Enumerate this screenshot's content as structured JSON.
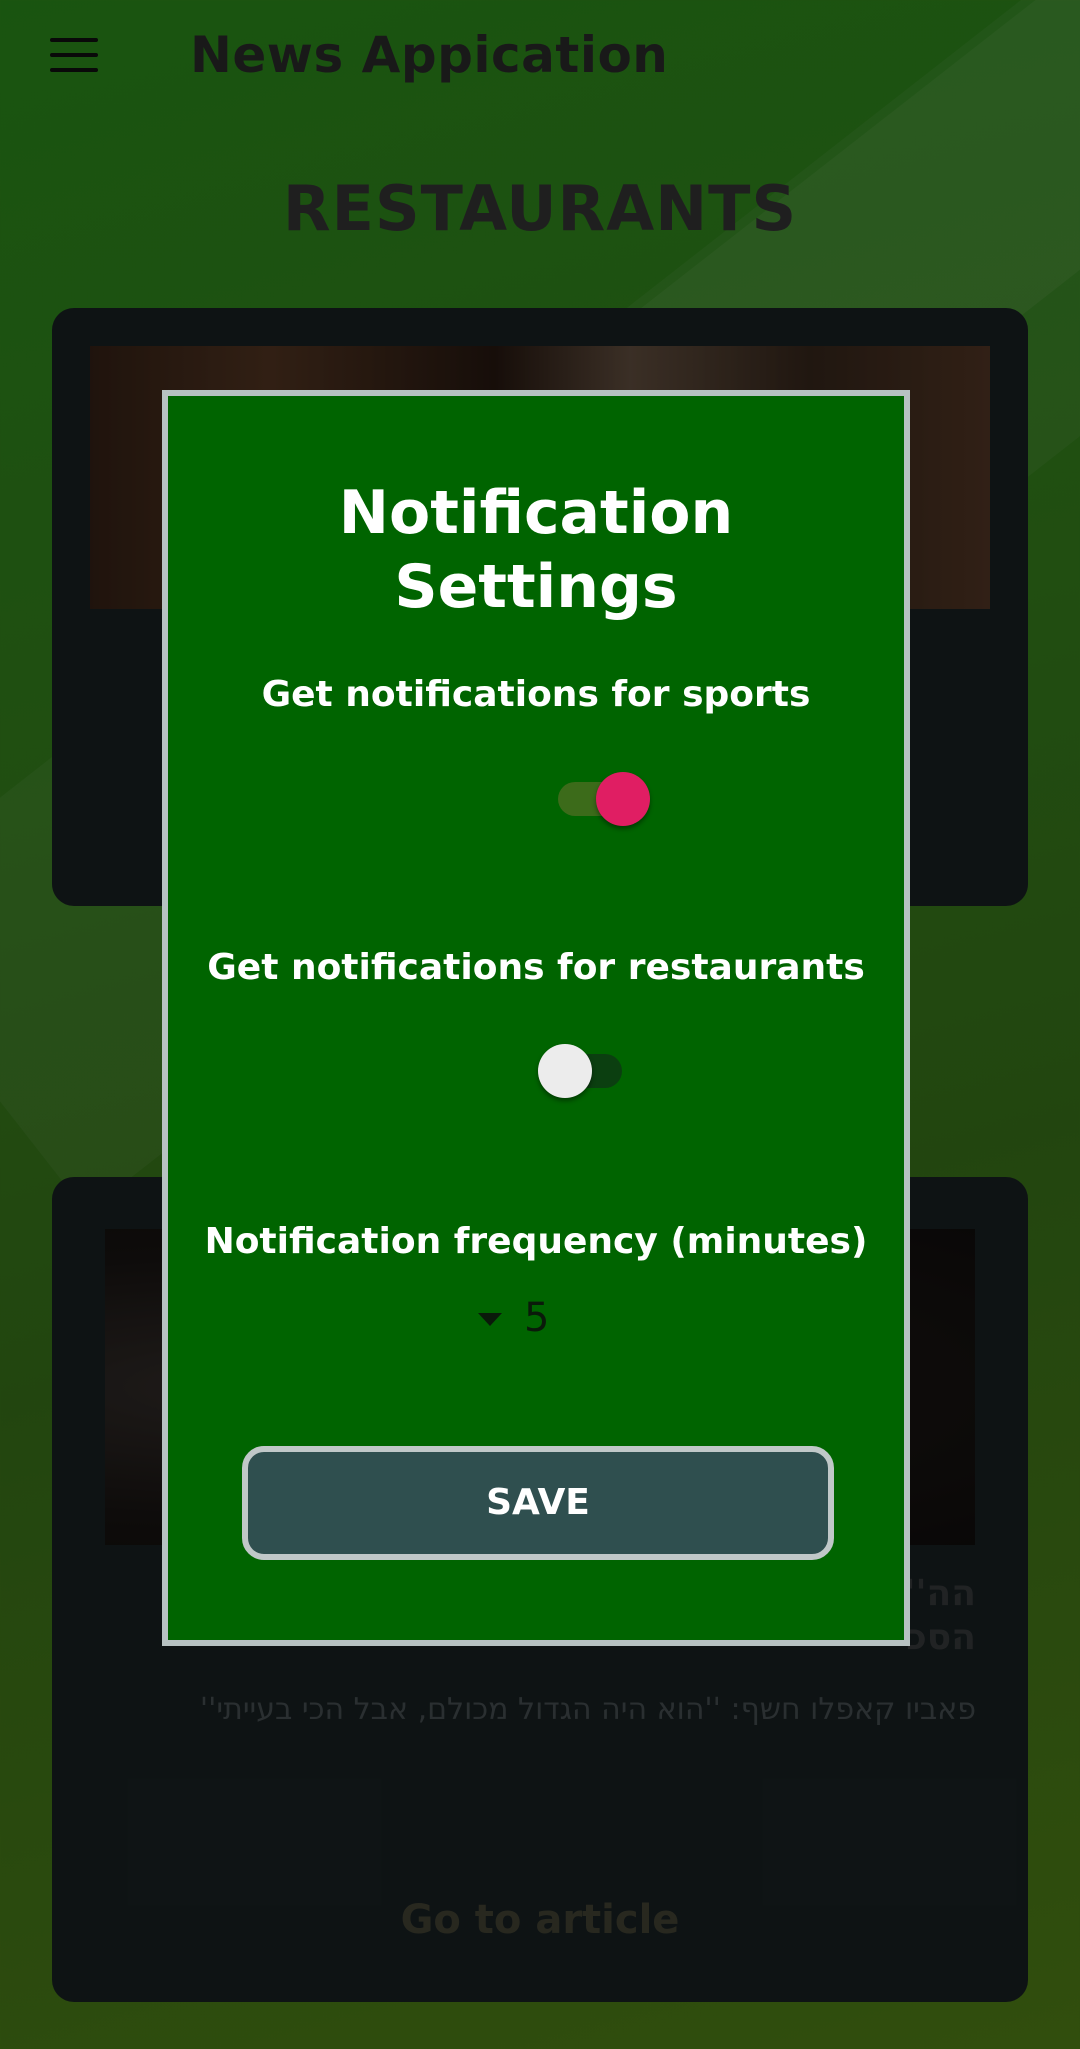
{
  "app": {
    "title": "News Appication",
    "menu_icon": "hamburger-menu-icon"
  },
  "section": {
    "title": "RESTAURANTS"
  },
  "cards": [
    {
      "image": "restaurant-interior-photo"
    },
    {
      "image": "person-photo",
      "headline": "''הה\nהסכ",
      "subtitle": "פאביו קאפלו חשף: ''הוא היה הגדול מכולם, אבל הכי בעייתי''",
      "link_label": "Go to article"
    }
  ],
  "dialog": {
    "title": "Notification Settings",
    "sports_label": "Get notifications for sports",
    "sports_enabled": true,
    "restaurants_label": "Get notifications for restaurants",
    "restaurants_enabled": false,
    "frequency_label": "Notification frequency (minutes)",
    "frequency_value": "5",
    "save_label": "SAVE",
    "colors": {
      "background": "#006400",
      "switch_on": "#e01e63",
      "button": "#2f4f4f"
    }
  }
}
